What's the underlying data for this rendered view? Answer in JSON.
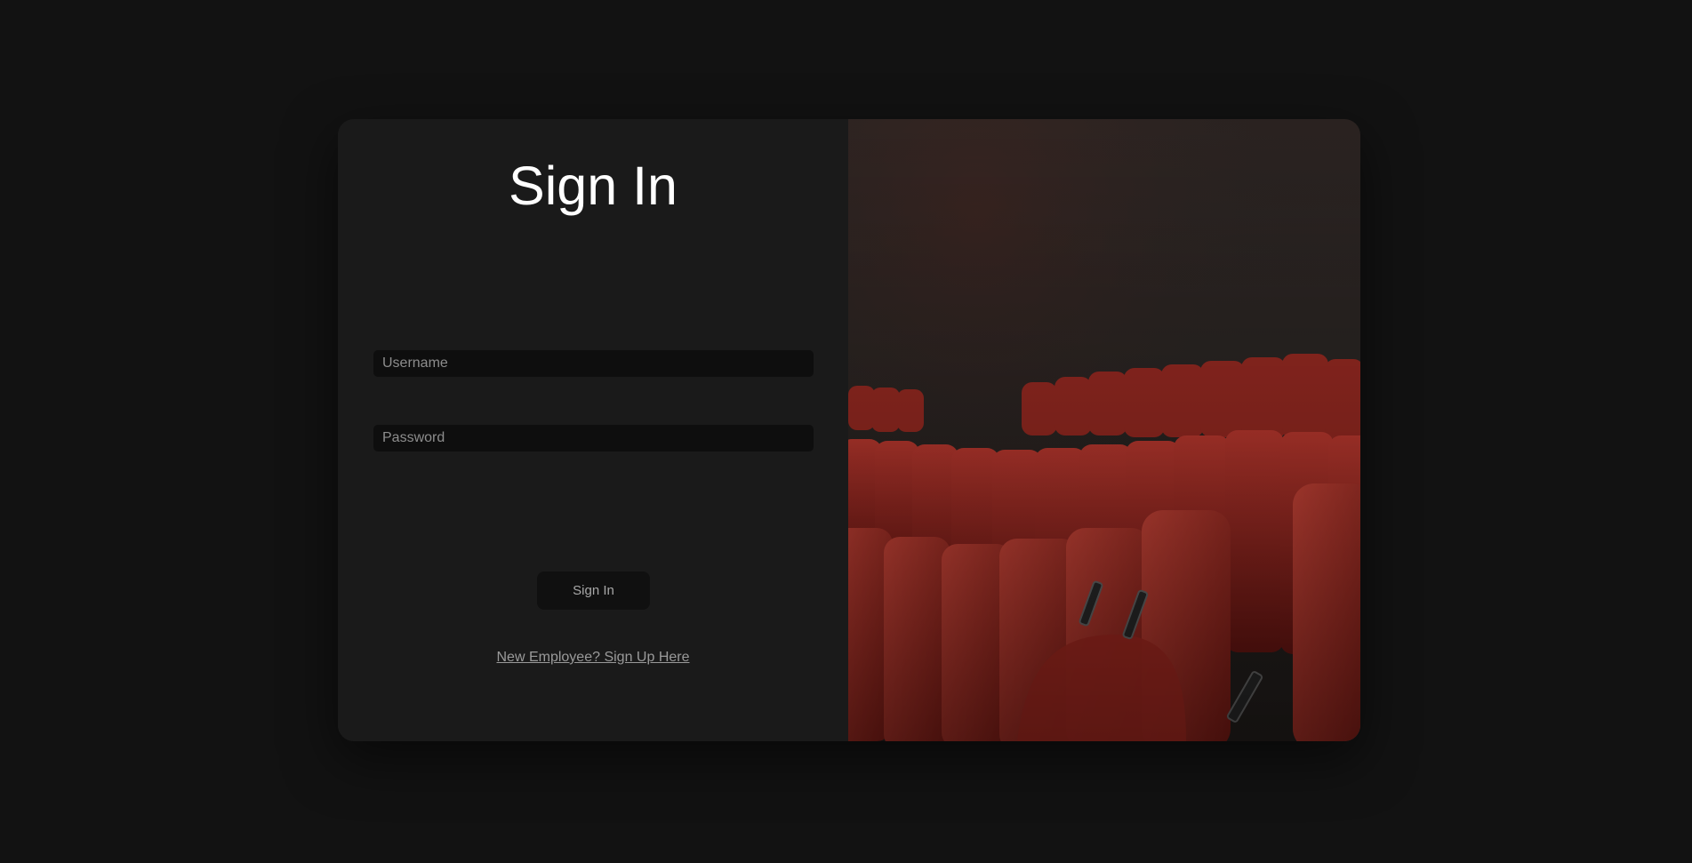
{
  "login": {
    "title": "Sign In",
    "username_placeholder": "Username",
    "password_placeholder": "Password",
    "submit_label": "Sign In",
    "signup_link": "New Employee? Sign Up Here"
  },
  "colors": {
    "background": "#121212",
    "card": "#1a1a1a",
    "seat_red": "#b5302a"
  },
  "images": {
    "hero": "cinema-seats-photo"
  }
}
